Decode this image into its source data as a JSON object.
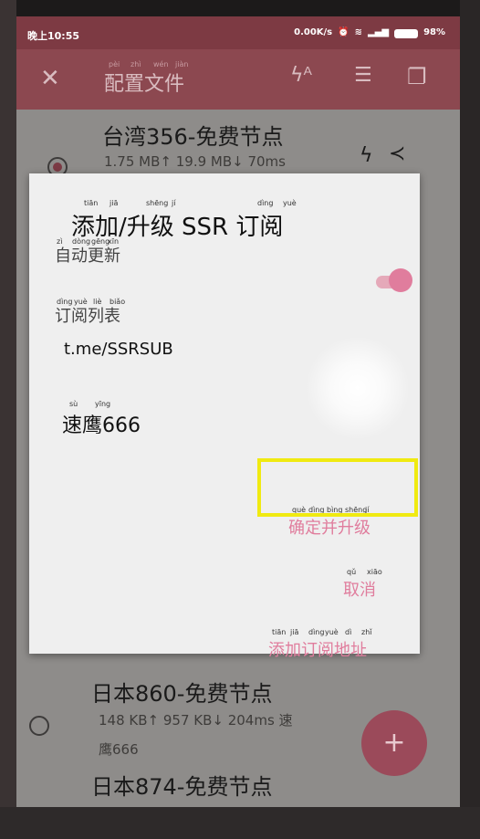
{
  "status_bar": {
    "time": "晚上10:55",
    "net_speed": "0.00K/s",
    "battery": "98%"
  },
  "toolbar": {
    "title": "配置文件",
    "title_pinyin": [
      "pèi",
      "zhì",
      "wén",
      "jiàn"
    ]
  },
  "list": [
    {
      "title": "台湾356-免费节点",
      "stats": "1.75 MB↑ 19.9 MB↓ 70ms",
      "selected": true
    },
    {
      "title": "日本860-免费节点",
      "stats": "148 KB↑ 957 KB↓ 204ms 速",
      "stats_cont": "鹰666",
      "selected": false
    },
    {
      "title": "日本874-免费节点",
      "selected": false
    }
  ],
  "dialog": {
    "title": "添加/升级 SSR 订阅",
    "title_pinyin": [
      "tiān",
      "jiā",
      "shēng",
      "jí",
      "dìng",
      "yuè"
    ],
    "auto_update_label": "自动更新",
    "auto_update_pinyin": [
      "zì",
      "dòng",
      "gēng",
      "xīn"
    ],
    "auto_update_on": true,
    "list_label": "订阅列表",
    "list_label_pinyin": [
      "dìng",
      "yuè",
      "liè",
      "biǎo"
    ],
    "subscriptions": [
      "t.me/SSRSUB"
    ],
    "subscription_name": "速鹰666",
    "subscription_name_pinyin": [
      "sù",
      "yīng"
    ],
    "actions": {
      "confirm": "确定并升级",
      "cancel": "取消",
      "add": "添加订阅地址"
    },
    "action_pinyin": {
      "confirm": [
        "què",
        "dìng",
        "bìng",
        "shēng",
        "jí"
      ],
      "cancel": [
        "qǔ",
        "xiāo"
      ],
      "add": [
        "tiān",
        "jiā",
        "dìng",
        "yuè",
        "dì",
        "zhǐ"
      ]
    }
  },
  "colors": {
    "accent": "#e07d9d",
    "toolbar": "#8c4850",
    "highlight": "#f0ea11"
  },
  "icons": [
    "close-icon",
    "flash-icon",
    "sort-icon",
    "copy-icon",
    "lightning-icon",
    "share-icon",
    "add-icon"
  ]
}
